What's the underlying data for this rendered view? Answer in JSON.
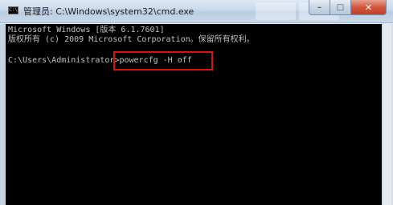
{
  "window": {
    "title": "管理员: C:\\Windows\\system32\\cmd.exe",
    "icon_label": "C:\\",
    "controls": {
      "minimize": "–",
      "maximize": "□",
      "close": "✕"
    }
  },
  "console": {
    "lines": [
      "Microsoft Windows [版本 6.1.7601]",
      "版权所有 (c) 2009 Microsoft Corporation。保留所有权利。",
      "",
      "C:\\Users\\Administrator>powercfg -H off"
    ]
  },
  "colors": {
    "console_bg": "#000000",
    "console_text": "#c0c0c0",
    "highlight": "#e0100a"
  },
  "icons": {
    "app": "cmd-icon",
    "minimize": "minimize-icon",
    "maximize": "maximize-icon",
    "close": "close-icon"
  }
}
